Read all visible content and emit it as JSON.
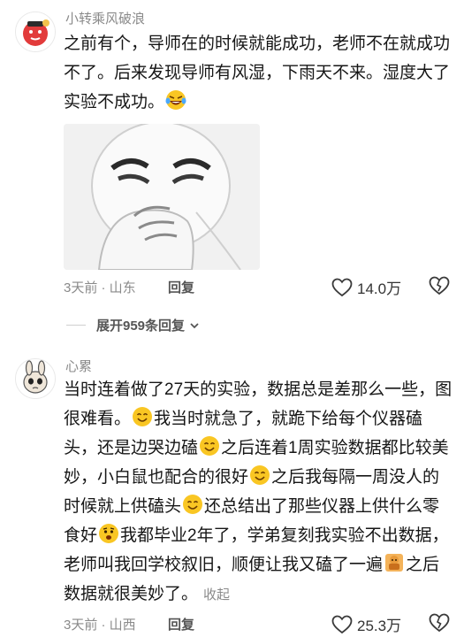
{
  "comments": [
    {
      "username": "小转乘风破浪",
      "text_parts": [
        "之前有个，导师在的时候就能成功，老师不在就成功不了。后来发现导师有风湿，下雨天不来。湿度大了实验不成功。"
      ],
      "meta": "3天前 · 山东",
      "reply_label": "回复",
      "like_count": "14.0万",
      "accent_color": "#e23b3b"
    },
    {
      "username": "心累",
      "text_parts": [
        "当时连着做了27天的实验，数据总是差那么一些，图很难看。",
        "我当时就急了，就跪下给每个仪器磕头，还是边哭边磕",
        "之后连着1周实验数据都比较美妙，小白鼠也配合的很好",
        "之后我每隔一周没人的时候就上供磕头",
        "还总结出了那些仪器上供什么零食好",
        "我都毕业2年了，学弟复刻我实验不出数据，老师叫我回学校叙旧，顺便让我又磕了一遍",
        "之后数据就很美妙了。"
      ],
      "collapse_label": "收起",
      "meta": "3天前 · 山西",
      "reply_label": "回复",
      "like_count": "25.3万"
    }
  ],
  "expand_replies_label": "展开959条回复",
  "icons": {
    "laugh": "laughing-crying-emoji",
    "smile": "smile-emoji",
    "worried": "worried-emoji",
    "bowing": "bowing-sticker-emoji",
    "like": "heart-outline-icon",
    "dislike": "broken-heart-icon",
    "chevron": "chevron-down-icon"
  }
}
